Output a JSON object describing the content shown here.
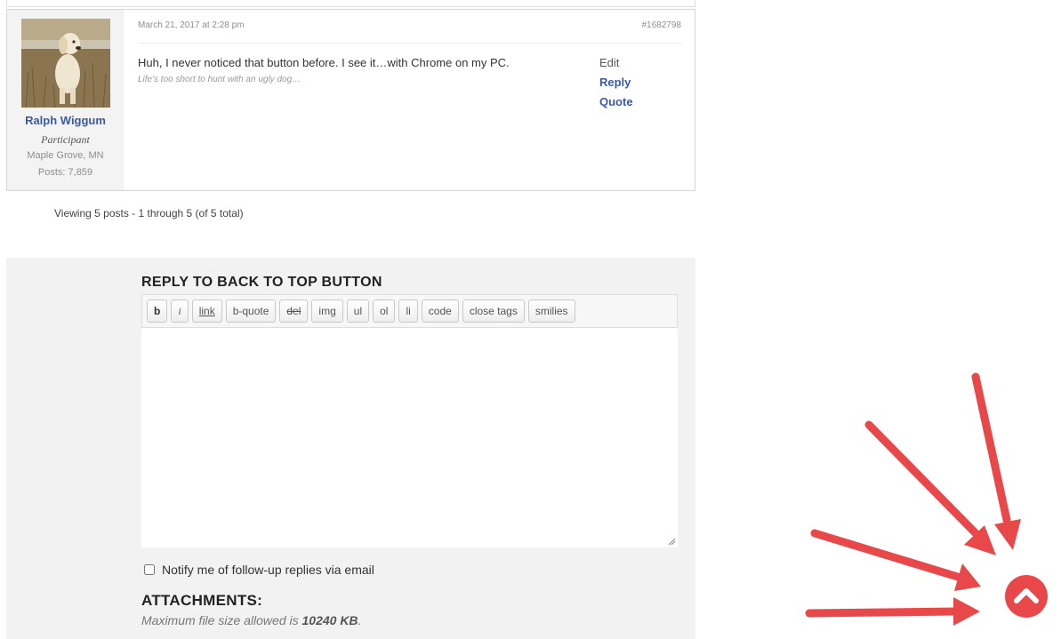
{
  "post": {
    "author": {
      "name": "Ralph Wiggum",
      "role": "Participant",
      "location": "Maple Grove, MN",
      "posts": "Posts: 7,859"
    },
    "date": "March 21, 2017 at 2:28 pm",
    "id": "#1682798",
    "body": "Huh, I never noticed that button before. I see it…with Chrome on my PC.",
    "signature": "Life's too short to hunt with an ugly dog…",
    "actions": {
      "edit": "Edit",
      "reply": "Reply",
      "quote": "Quote"
    }
  },
  "pagination": {
    "viewing": "Viewing 5 posts - 1 through 5 (of 5 total)"
  },
  "reply_form": {
    "title": "REPLY TO BACK TO TOP BUTTON",
    "toolbar": [
      "b",
      "i",
      "link",
      "b-quote",
      "del",
      "img",
      "ul",
      "ol",
      "li",
      "code",
      "close tags",
      "smilies"
    ],
    "editor_value": "",
    "notify_label": "Notify me of follow-up replies via email",
    "notify_checked": false,
    "attachments_title": "ATTACHMENTS:",
    "attachments_note_prefix": "Maximum file size allowed is ",
    "attachments_note_size": "10240 KB",
    "attachments_note_suffix": "."
  },
  "overlay": {
    "back_to_top_icon": "chevron-up-icon",
    "arrow_color": "#e9484a"
  },
  "colors": {
    "link": "#3a5aa8",
    "accent_red": "#e9484a",
    "panel_bg": "#f2f2f2"
  }
}
